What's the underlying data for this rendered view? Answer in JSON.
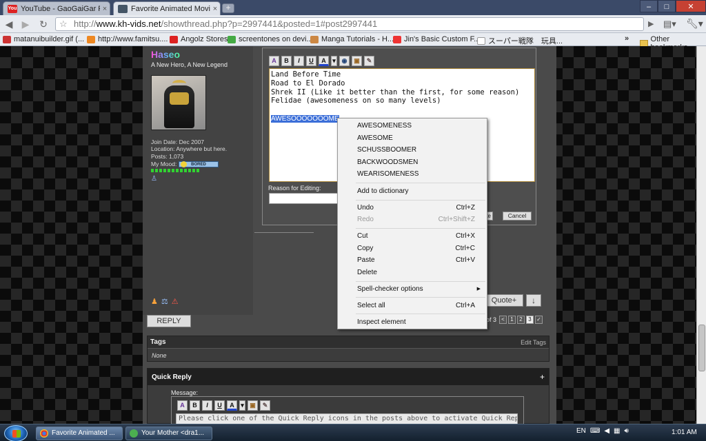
{
  "browser": {
    "tabs": [
      {
        "title": "YouTube - GaoGaiGar Fin..."
      },
      {
        "title": "Favorite Animated Movie..."
      }
    ],
    "new_tab_label": "+",
    "url_scheme": "http://",
    "url_host": "www.kh-vids.net",
    "url_path": "/showthread.php?p=2997441&posted=1#post2997441",
    "bookmarks": [
      {
        "label": "matanuibuilder.gif (..."
      },
      {
        "label": "http://www.famitsu...."
      },
      {
        "label": "Angolz Stores"
      },
      {
        "label": "screentones on devi..."
      },
      {
        "label": "Manga Tutorials - H..."
      },
      {
        "label": "Jin's Basic Custom F..."
      },
      {
        "label": "スーパー戦隊　玩具..."
      }
    ],
    "bookmarks_overflow": "»",
    "other_bookmarks": "Other bookmarks"
  },
  "user": {
    "name": "Haseo",
    "title": "A New Hero, A New Legend",
    "join_date": "Join Date: Dec 2007",
    "location": "Location: Anywhere but here.",
    "posts": "Posts: 1,073",
    "mood_label": "My Mood:",
    "mood": "BORED"
  },
  "editor": {
    "lines": [
      "Land Before Time",
      "Road to El Dorado",
      "Shrek II (Like it better than the first, for some reason)",
      "Felidae (awesomeness on so many levels)"
    ],
    "selected_word": "AWESOOOOOOOME",
    "reason_label": "Reason for Editing:",
    "reason_value": "",
    "save_label": "te",
    "cancel_label": "Cancel",
    "tools": [
      "A",
      "B",
      "I",
      "U",
      "A",
      "▾",
      "◉",
      "▣",
      "✎"
    ]
  },
  "context_menu": {
    "suggestions": [
      "AWESOMENESS",
      "AWESOME",
      "SCHUSSBOOMER",
      "BACKWOODSMEN",
      "WEARISOMENESS"
    ],
    "add_to_dictionary": "Add to dictionary",
    "undo": {
      "label": "Undo",
      "shortcut": "Ctrl+Z"
    },
    "redo": {
      "label": "Redo",
      "shortcut": "Ctrl+Shift+Z"
    },
    "cut": {
      "label": "Cut",
      "shortcut": "Ctrl+X"
    },
    "copy": {
      "label": "Copy",
      "shortcut": "Ctrl+C"
    },
    "paste": {
      "label": "Paste",
      "shortcut": "Ctrl+V"
    },
    "delete": {
      "label": "Delete"
    },
    "spell_options": "Spell-checker options",
    "select_all": {
      "label": "Select all",
      "shortcut": "Ctrl+A"
    },
    "inspect": "Inspect element"
  },
  "post_actions": {
    "quote_plus": "Quote+",
    "reply": "REPLY",
    "pager_text": "of 3",
    "pages": [
      "<",
      "1",
      "2",
      "3",
      "✓"
    ]
  },
  "tags": {
    "label": "Tags",
    "edit_label": "Edit Tags",
    "value": "None"
  },
  "quick_reply": {
    "label": "Quick Reply",
    "toggle": "+",
    "message_label": "Message:",
    "placeholder": "Please click one of the Quick Reply icons in the posts above to activate Quick Reply."
  },
  "taskbar": {
    "items": [
      {
        "label": "Favorite Animated ..."
      },
      {
        "label": "Your Mother <dra1..."
      }
    ],
    "language": "EN",
    "clock": "1:01 AM"
  }
}
